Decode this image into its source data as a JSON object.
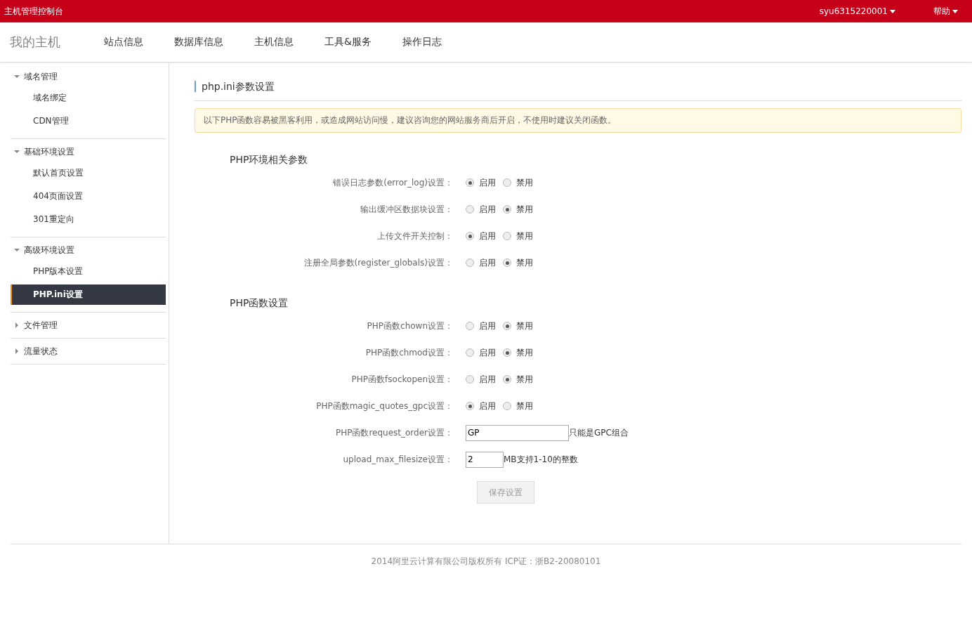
{
  "topbar": {
    "title": "主机管理控制台",
    "user": "syu6315220001",
    "help": "帮助"
  },
  "nav": {
    "brand": "我的主机",
    "items": [
      "站点信息",
      "数据库信息",
      "主机信息",
      "工具&服务",
      "操作日志"
    ]
  },
  "sidebar": [
    {
      "label": "域名管理",
      "expanded": true,
      "children": [
        {
          "label": "域名绑定",
          "selected": false
        },
        {
          "label": "CDN管理",
          "selected": false
        }
      ]
    },
    {
      "label": "基础环境设置",
      "expanded": true,
      "children": [
        {
          "label": "默认首页设置",
          "selected": false
        },
        {
          "label": "404页面设置",
          "selected": false
        },
        {
          "label": "301重定向",
          "selected": false
        }
      ]
    },
    {
      "label": "高级环境设置",
      "expanded": true,
      "children": [
        {
          "label": "PHP版本设置",
          "selected": false
        },
        {
          "label": "PHP.ini设置",
          "selected": true
        }
      ]
    },
    {
      "label": "文件管理",
      "expanded": false
    },
    {
      "label": "流量状态",
      "expanded": false
    }
  ],
  "page": {
    "title": "php.ini参数设置",
    "notice": "以下PHP函数容易被黑客利用，或造成网站访问慢，建议咨询您的网站服务商后开启，不使用时建议关闭函数。"
  },
  "sections": [
    {
      "title": "PHP环境相关参数",
      "rows": [
        {
          "kind": "radio",
          "label": "错误日志参数(error_log)设置：",
          "options": [
            {
              "label": "启用",
              "selected": true
            },
            {
              "label": "禁用",
              "selected": false
            }
          ]
        },
        {
          "kind": "radio",
          "label": "输出缓冲区数据块设置：",
          "options": [
            {
              "label": "启用",
              "selected": false
            },
            {
              "label": "禁用",
              "selected": true
            }
          ]
        },
        {
          "kind": "radio",
          "label": "上传文件开关控制：",
          "options": [
            {
              "label": "启用",
              "selected": true
            },
            {
              "label": "禁用",
              "selected": false
            }
          ]
        },
        {
          "kind": "radio",
          "label": "注册全局参数(register_globals)设置：",
          "options": [
            {
              "label": "启用",
              "selected": false
            },
            {
              "label": "禁用",
              "selected": true
            }
          ]
        }
      ]
    },
    {
      "title": "PHP函数设置",
      "rows": [
        {
          "kind": "radio",
          "label": "PHP函数chown设置：",
          "options": [
            {
              "label": "启用",
              "selected": false
            },
            {
              "label": "禁用",
              "selected": true
            }
          ]
        },
        {
          "kind": "radio",
          "label": "PHP函数chmod设置：",
          "options": [
            {
              "label": "启用",
              "selected": false
            },
            {
              "label": "禁用",
              "selected": true
            }
          ]
        },
        {
          "kind": "radio",
          "label": "PHP函数fsockopen设置：",
          "options": [
            {
              "label": "启用",
              "selected": false
            },
            {
              "label": "禁用",
              "selected": true
            }
          ]
        },
        {
          "kind": "radio",
          "label": "PHP函数magic_quotes_gpc设置：",
          "options": [
            {
              "label": "启用",
              "selected": true
            },
            {
              "label": "禁用",
              "selected": false
            }
          ]
        },
        {
          "kind": "input",
          "label": "PHP函数request_order设置：",
          "value": "GP",
          "hint": "只能是GPC组合",
          "wide": true
        },
        {
          "kind": "input",
          "label": "upload_max_filesize设置：",
          "value": "2",
          "hint": "MB支持1-10的整数",
          "wide": false
        }
      ]
    }
  ],
  "save_button": "保存设置",
  "footer": "2014阿里云计算有限公司版权所有 ICP证：浙B2-20080101"
}
